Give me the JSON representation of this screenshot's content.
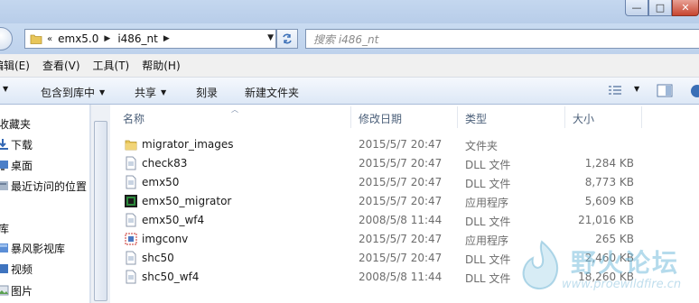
{
  "window": {
    "buttons": {
      "minimize": "—",
      "maximize": "□",
      "close": "✕"
    }
  },
  "address": {
    "lead": "«",
    "crumbs": [
      "emx5.0",
      "i486_nt"
    ],
    "search_placeholder": "搜索 i486_nt"
  },
  "menu": [
    "编辑(E)",
    "查看(V)",
    "工具(T)",
    "帮助(H)"
  ],
  "toolbar": {
    "include_library": "包含到库中",
    "share": "共享",
    "burn": "刻录",
    "new_folder": "新建文件夹"
  },
  "nav": {
    "favorites_header": "收藏夹",
    "favorites": [
      "下载",
      "桌面",
      "最近访问的位置"
    ],
    "library_header": "库",
    "library": [
      "暴风影视库",
      "视频",
      "图片"
    ]
  },
  "columns": {
    "name": "名称",
    "date": "修改日期",
    "type": "类型",
    "size": "大小"
  },
  "files": [
    {
      "name": "migrator_images",
      "date": "2015/5/7 20:47",
      "type": "文件夹",
      "size": "",
      "icon": "folder-icon"
    },
    {
      "name": "check83",
      "date": "2015/5/7 20:47",
      "type": "DLL 文件",
      "size": "1,284 KB",
      "icon": "dll-file-icon"
    },
    {
      "name": "emx50",
      "date": "2015/5/7 20:47",
      "type": "DLL 文件",
      "size": "8,773 KB",
      "icon": "dll-file-icon"
    },
    {
      "name": "emx50_migrator",
      "date": "2015/5/7 20:47",
      "type": "应用程序",
      "size": "5,609 KB",
      "icon": "app-icon"
    },
    {
      "name": "emx50_wf4",
      "date": "2008/5/8 11:44",
      "type": "DLL 文件",
      "size": "21,016 KB",
      "icon": "dll-file-icon"
    },
    {
      "name": "imgconv",
      "date": "2015/5/7 20:47",
      "type": "应用程序",
      "size": "265 KB",
      "icon": "exe-icon"
    },
    {
      "name": "shc50",
      "date": "2015/5/7 20:47",
      "type": "DLL 文件",
      "size": "2,460 KB",
      "icon": "dll-file-icon"
    },
    {
      "name": "shc50_wf4",
      "date": "2008/5/8 11:44",
      "type": "DLL 文件",
      "size": "18,260 KB",
      "icon": "dll-file-icon"
    }
  ],
  "watermark": {
    "title": "野火论坛",
    "url": "www.proewildfire.cn"
  }
}
